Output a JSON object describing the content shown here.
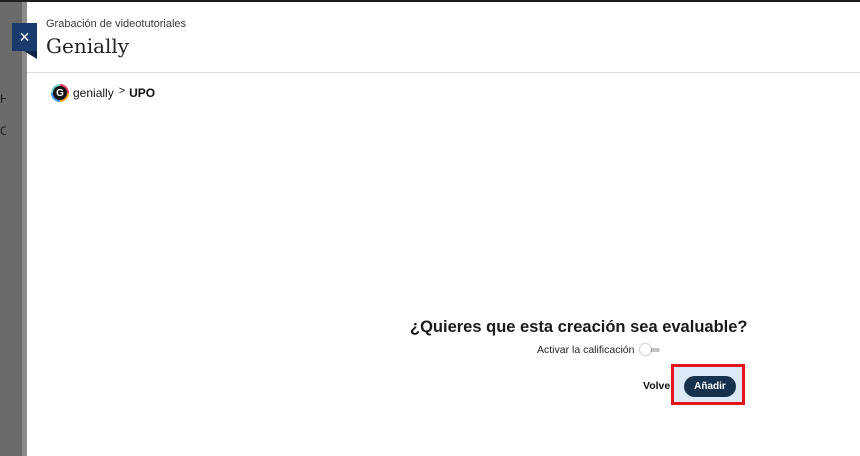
{
  "modal": {
    "subtitle": "Grabación de videotutoriales",
    "title": "Genially",
    "close_icon": "×"
  },
  "backdrop": {
    "visible_chars": [
      "H",
      "C"
    ]
  },
  "breadcrumb": {
    "logo_letter": "G",
    "brand": "genially",
    "separator": ">",
    "current": "UPO"
  },
  "evaluation": {
    "question": "¿Quieres que esta creación sea evaluable?",
    "toggle_label": "Activar la calificación",
    "toggle_on": false
  },
  "actions": {
    "back_label": "Volver",
    "add_label": "Añadir"
  },
  "colors": {
    "accent": "#1a3b6e",
    "button": "#16324f",
    "highlight_border": "#e5141b"
  }
}
